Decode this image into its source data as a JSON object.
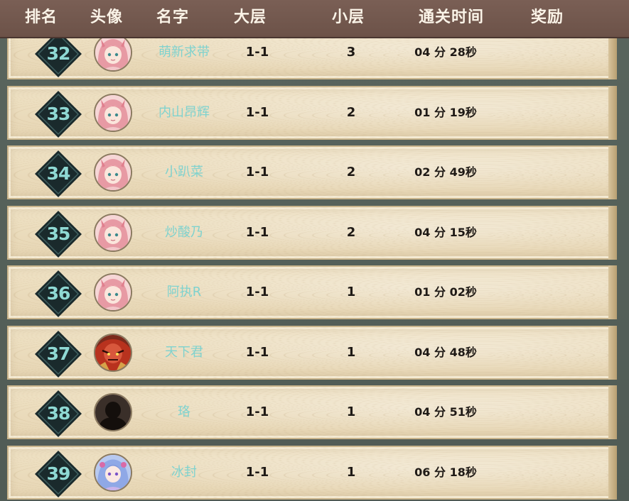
{
  "header": {
    "rank": "排名",
    "avatar": "头像",
    "name": "名字",
    "major_floor": "大层",
    "minor_floor": "小层",
    "clear_time": "通关时间",
    "reward": "奖励"
  },
  "rows": [
    {
      "rank": "32",
      "avatar": "pink-hair-girl-avatar",
      "name": "萌新求带",
      "major": "1-1",
      "minor": "3",
      "time": "04 分 28秒"
    },
    {
      "rank": "33",
      "avatar": "pink-hair-girl-avatar",
      "name": "内山昂辉",
      "major": "1-1",
      "minor": "2",
      "time": "01 分 19秒"
    },
    {
      "rank": "34",
      "avatar": "pink-hair-girl-avatar",
      "name": "小趴菜",
      "major": "1-1",
      "minor": "2",
      "time": "02 分 49秒"
    },
    {
      "rank": "35",
      "avatar": "pink-hair-girl-avatar",
      "name": "炒酸乃",
      "major": "1-1",
      "minor": "2",
      "time": "04 分 15秒"
    },
    {
      "rank": "36",
      "avatar": "pink-hair-girl-avatar",
      "name": "阿执R",
      "major": "1-1",
      "minor": "1",
      "time": "01 分 02秒"
    },
    {
      "rank": "37",
      "avatar": "red-warrior-avatar",
      "name": "天下君",
      "major": "1-1",
      "minor": "1",
      "time": "04 分 48秒"
    },
    {
      "rank": "38",
      "avatar": "shadow-silhouette-avatar",
      "name": "珞",
      "major": "1-1",
      "minor": "1",
      "time": "04 分 51秒"
    },
    {
      "rank": "39",
      "avatar": "blue-hair-girl-avatar",
      "name": "冰封",
      "major": "1-1",
      "minor": "1",
      "time": "06 分 18秒"
    }
  ],
  "colors": {
    "header_bg": "#6c5248",
    "row_bg": "#e9d9b8",
    "rank_text": "#8fd9d4",
    "name_text": "#7fd2ce",
    "badge_dark": "#1a2a2c"
  }
}
